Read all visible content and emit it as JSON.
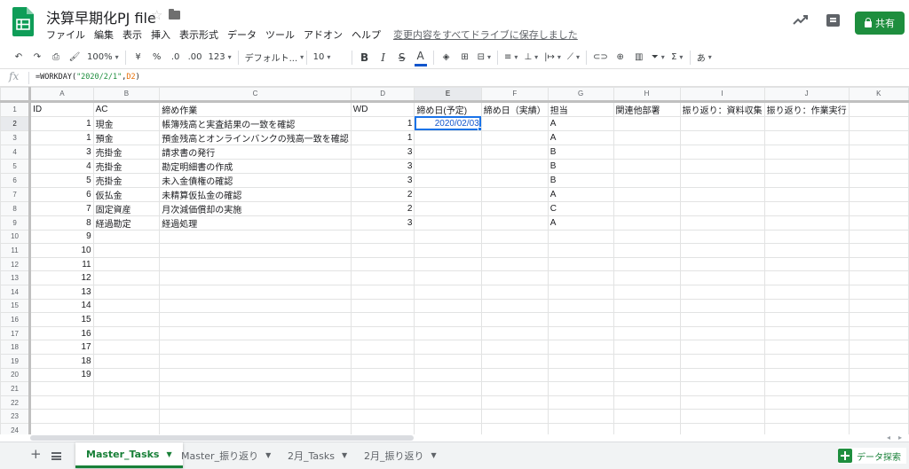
{
  "app": {
    "doc_title": "決算早期化PJ file",
    "menus": [
      "ファイル",
      "編集",
      "表示",
      "挿入",
      "表示形式",
      "データ",
      "ツール",
      "アドオン",
      "ヘルプ"
    ],
    "save_status": "変更内容をすべてドライブに保存しました",
    "share_label": "共有",
    "brand_color": "#0f9d58",
    "share_color": "#1e8e3e"
  },
  "toolbar": {
    "zoom": "100%",
    "currency": "¥",
    "percent": "%",
    "decimal_less": ".0",
    "decimal_more": ".00",
    "more_formats": "123",
    "font": "デフォルト...",
    "font_size": "10",
    "bold": "B",
    "italic": "I",
    "strike": "S",
    "text_color": "A",
    "input_tools": "あ",
    "icons": [
      "undo-icon",
      "redo-icon",
      "print-icon",
      "paint-format-icon",
      "fill-color-icon",
      "borders-icon",
      "merge-icon",
      "align-left-icon",
      "valign-bottom-icon",
      "wrap-icon",
      "rotate-icon",
      "link-icon",
      "insert-comment-icon",
      "insert-chart-icon",
      "filter-icon",
      "functions-icon"
    ]
  },
  "formula_bar": {
    "fx": "fx",
    "prefix": "=WORKDAY(",
    "arg1": "\"2020/2/1\"",
    "comma": ",",
    "arg2": "D2",
    "suffix": ")"
  },
  "sheet": {
    "columns": [
      "A",
      "B",
      "C",
      "D",
      "E",
      "F",
      "G",
      "H",
      "I",
      "J",
      "K"
    ],
    "header_row": [
      "ID",
      "AC",
      "締め作業",
      "WD",
      "締め日(予定)",
      "締め日（実績）",
      "担当",
      "関連他部署",
      "振り返り：資料収集",
      "振り返り：作業実行",
      ""
    ],
    "rows": [
      {
        "id": "1",
        "ac": "現金",
        "task": "帳簿残高と実査結果の一致を確認",
        "wd": "1",
        "planned": "2020/02/03",
        "owner": "A"
      },
      {
        "id": "1",
        "ac": "預金",
        "task": "預金残高とオンラインバンクの残高一致を確認",
        "wd": "1",
        "planned": "",
        "owner": "A"
      },
      {
        "id": "3",
        "ac": "売掛金",
        "task": "請求書の発行",
        "wd": "3",
        "planned": "",
        "owner": "B"
      },
      {
        "id": "4",
        "ac": "売掛金",
        "task": "勘定明細書の作成",
        "wd": "3",
        "planned": "",
        "owner": "B"
      },
      {
        "id": "5",
        "ac": "売掛金",
        "task": "未入金債権の確認",
        "wd": "3",
        "planned": "",
        "owner": "B"
      },
      {
        "id": "6",
        "ac": "仮払金",
        "task": "未精算仮払金の確認",
        "wd": "2",
        "planned": "",
        "owner": "A"
      },
      {
        "id": "7",
        "ac": "固定資産",
        "task": "月次減価償却の実施",
        "wd": "2",
        "planned": "",
        "owner": "C"
      },
      {
        "id": "8",
        "ac": "経過勘定",
        "task": "経過処理",
        "wd": "3",
        "planned": "",
        "owner": "A"
      },
      {
        "id": "9",
        "ac": "",
        "task": "",
        "wd": "",
        "planned": "",
        "owner": ""
      },
      {
        "id": "10",
        "ac": "",
        "task": "",
        "wd": "",
        "planned": "",
        "owner": ""
      },
      {
        "id": "11",
        "ac": "",
        "task": "",
        "wd": "",
        "planned": "",
        "owner": ""
      },
      {
        "id": "12",
        "ac": "",
        "task": "",
        "wd": "",
        "planned": "",
        "owner": ""
      },
      {
        "id": "13",
        "ac": "",
        "task": "",
        "wd": "",
        "planned": "",
        "owner": ""
      },
      {
        "id": "14",
        "ac": "",
        "task": "",
        "wd": "",
        "planned": "",
        "owner": ""
      },
      {
        "id": "15",
        "ac": "",
        "task": "",
        "wd": "",
        "planned": "",
        "owner": ""
      },
      {
        "id": "16",
        "ac": "",
        "task": "",
        "wd": "",
        "planned": "",
        "owner": ""
      },
      {
        "id": "17",
        "ac": "",
        "task": "",
        "wd": "",
        "planned": "",
        "owner": ""
      },
      {
        "id": "18",
        "ac": "",
        "task": "",
        "wd": "",
        "planned": "",
        "owner": ""
      },
      {
        "id": "19",
        "ac": "",
        "task": "",
        "wd": "",
        "planned": "",
        "owner": ""
      },
      {
        "id": "",
        "ac": "",
        "task": "",
        "wd": "",
        "planned": "",
        "owner": ""
      },
      {
        "id": "",
        "ac": "",
        "task": "",
        "wd": "",
        "planned": "",
        "owner": ""
      },
      {
        "id": "",
        "ac": "",
        "task": "",
        "wd": "",
        "planned": "",
        "owner": ""
      },
      {
        "id": "",
        "ac": "",
        "task": "",
        "wd": "",
        "planned": "",
        "owner": ""
      }
    ],
    "row_numbers": [
      "1",
      "2",
      "3",
      "4",
      "5",
      "6",
      "7",
      "8",
      "9",
      "10",
      "11",
      "12",
      "13",
      "14",
      "15",
      "16",
      "17",
      "18",
      "19",
      "20",
      "21",
      "22",
      "23",
      "24"
    ],
    "selected_cell": "E2"
  },
  "tabs": [
    {
      "label": "Master_Tasks",
      "active": true
    },
    {
      "label": "Master_振り返り",
      "active": false
    },
    {
      "label": "2月_Tasks",
      "active": false
    },
    {
      "label": "2月_振り返り",
      "active": false
    }
  ],
  "explore_label": "データ探索"
}
